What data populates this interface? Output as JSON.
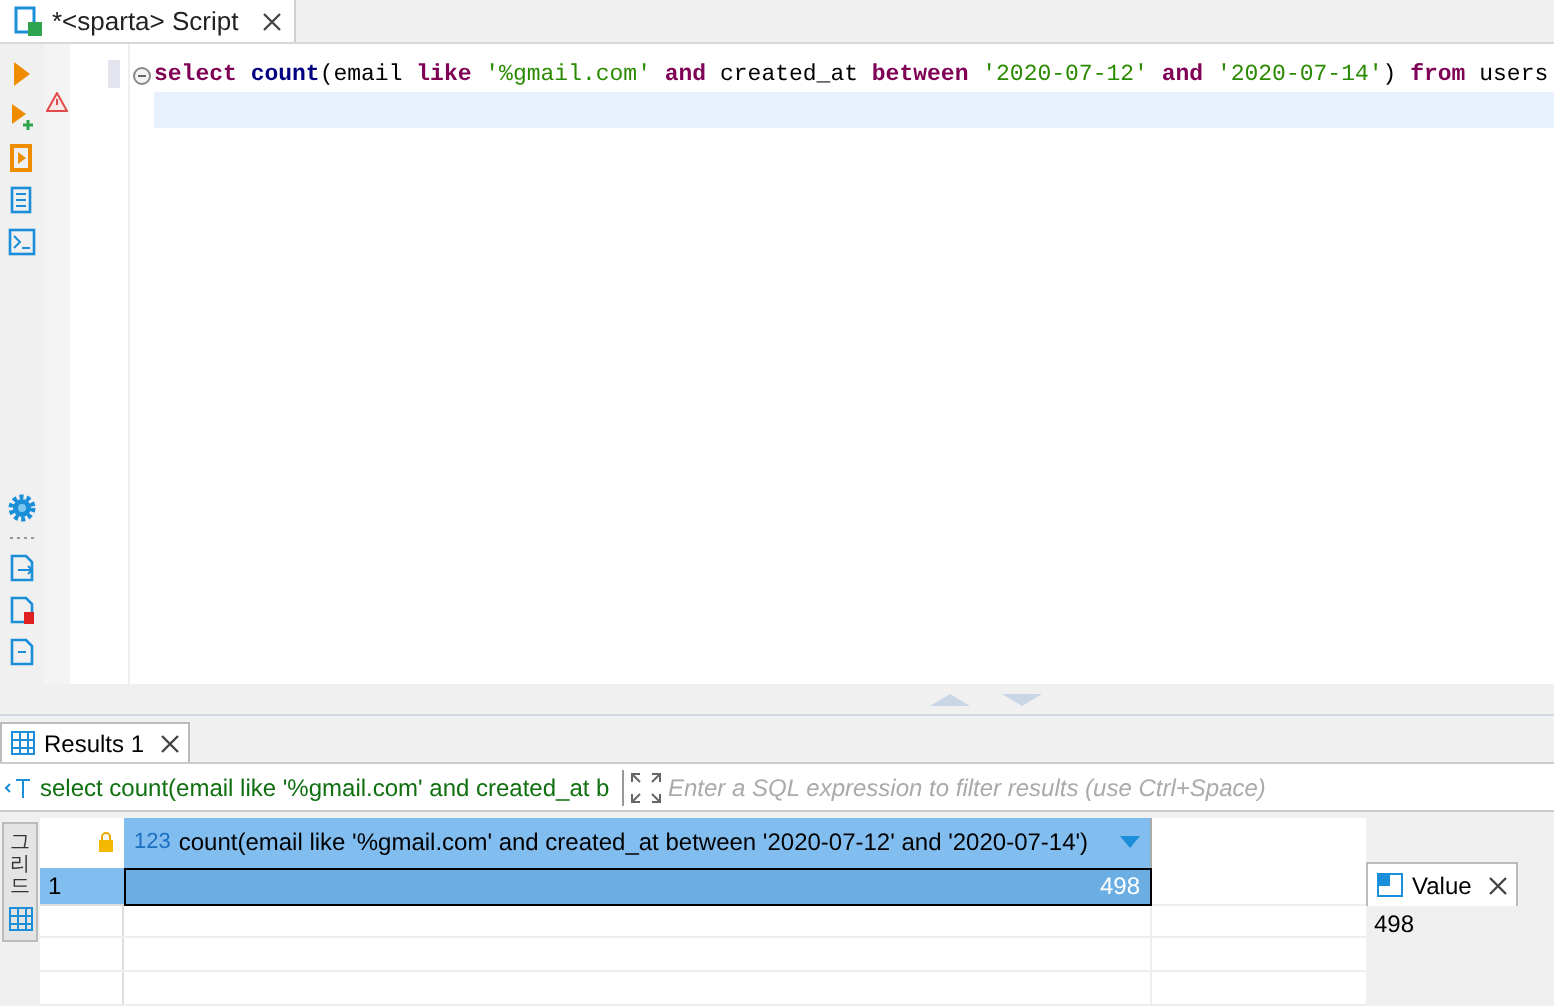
{
  "editor_tab": {
    "title": "*<sparta> Script",
    "selected": true
  },
  "code_line": [
    {
      "kind": "keyword",
      "text": "select "
    },
    {
      "kind": "function",
      "text": "count"
    },
    {
      "kind": "plain",
      "text": "(email "
    },
    {
      "kind": "keyword",
      "text": "like "
    },
    {
      "kind": "string",
      "text": "'%gmail.com' "
    },
    {
      "kind": "keyword",
      "text": "and "
    },
    {
      "kind": "plain",
      "text": "created_at "
    },
    {
      "kind": "keyword",
      "text": "between "
    },
    {
      "kind": "string",
      "text": "'2020-07-12' "
    },
    {
      "kind": "keyword",
      "text": "and "
    },
    {
      "kind": "string",
      "text": "'2020-07-14'"
    },
    {
      "kind": "plain",
      "text": ") "
    },
    {
      "kind": "keyword",
      "text": "from "
    },
    {
      "kind": "plain",
      "text": "users"
    }
  ],
  "results_tab": {
    "title": "Results 1",
    "selected": true
  },
  "filter": {
    "query": "select count(email like '%gmail.com' and created_at b",
    "placeholder": "Enter a SQL expression to filter results (use Ctrl+Space)"
  },
  "side_tab": "그리드",
  "table": {
    "columns": [
      {
        "type_label": "123",
        "name": "count(email like '%gmail.com' and created_at between '2020-07-12' and '2020-07-14')"
      }
    ],
    "rows": [
      {
        "number": "1",
        "selected": true,
        "cells": [
          "498"
        ]
      }
    ]
  },
  "value_panel": {
    "title": "Value",
    "value": "498"
  }
}
